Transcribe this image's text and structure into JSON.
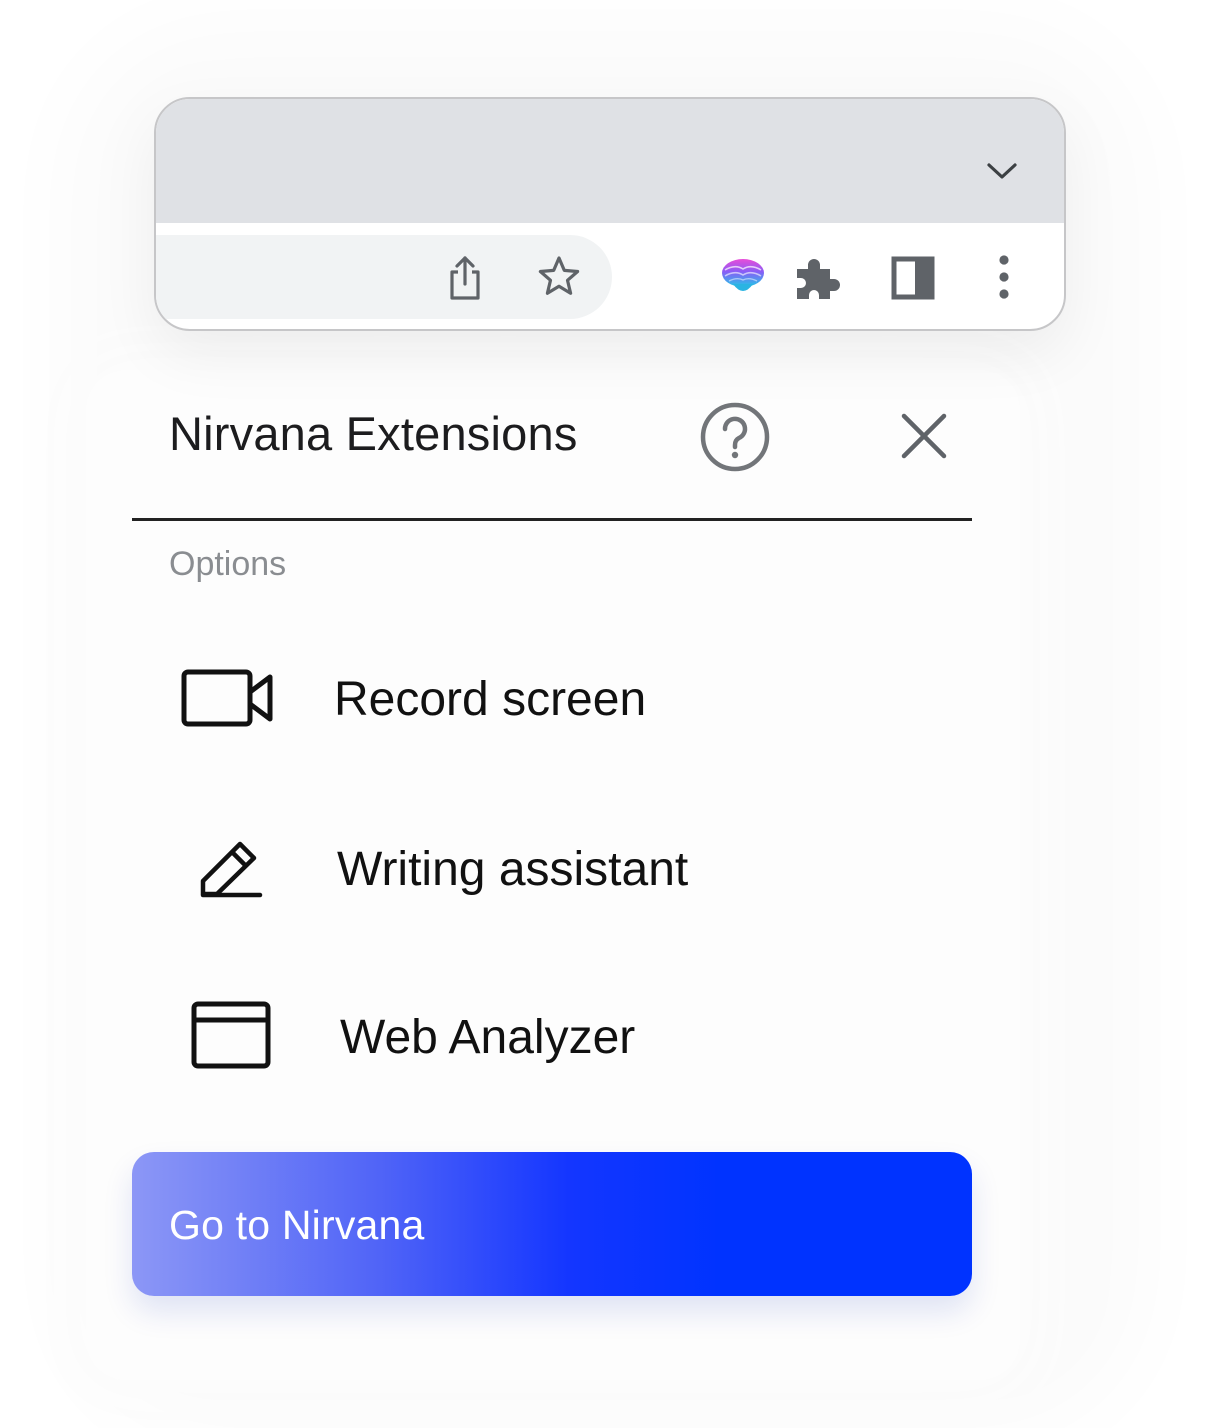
{
  "browser": {
    "tab_search_icon": "chevron-down-icon",
    "toolbar_icons": [
      "share-icon",
      "star-icon",
      "nirvana-extension-icon",
      "extensions-puzzle-icon",
      "side-panel-icon",
      "more-vert-icon"
    ]
  },
  "popup": {
    "title": "Nirvana Extensions",
    "help_icon": "help-circle-icon",
    "close_icon": "close-icon",
    "section_label": "Options",
    "options": [
      {
        "label": "Record screen",
        "icon": "video-camera-icon"
      },
      {
        "label": "Writing assistant",
        "icon": "pencil-icon"
      },
      {
        "label": "Web Analyzer",
        "icon": "browser-window-icon"
      }
    ],
    "cta_label": "Go to Nirvana"
  },
  "colors": {
    "accent": "#0033ff",
    "gradient_start": "#8c97f6",
    "text": "#111111",
    "muted": "#8a8d91",
    "tabstrip": "#dfe1e5",
    "omnibox": "#f1f3f4"
  }
}
